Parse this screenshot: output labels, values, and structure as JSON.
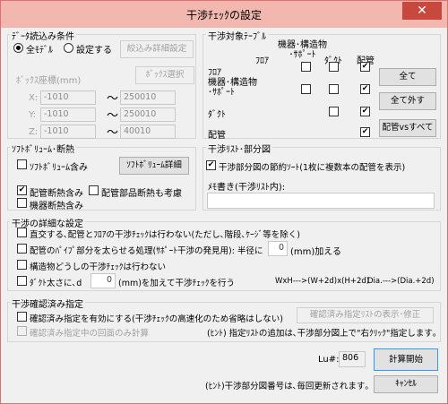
{
  "window": {
    "title": "干渉ﾁｪｯｸの設定",
    "close_glyph": "✕"
  },
  "data_load": {
    "label": "ﾃﾞｰﾀ読込み条件",
    "radio_all": "全ﾓﾃﾞﾙ",
    "radio_set": "設定する",
    "detail_button": "絞込み詳細設定",
    "box_label": "ﾎﾞｯｸｽ座標(mm)",
    "box_button": "ﾎﾞｯｸｽ選択",
    "coords": [
      {
        "axis": "X:",
        "min": "-1010",
        "max": "250010"
      },
      {
        "axis": "Y:",
        "min": "-1010",
        "max": "250010"
      },
      {
        "axis": "Z:",
        "min": "-1010",
        "max": "40010"
      }
    ],
    "tilde": "～"
  },
  "target_table": {
    "label": "干渉対象ﾃｰﾌﾞﾙ",
    "col_headers": [
      "ﾌﾛｱ",
      "機器･構造物\n･ｻﾎﾟｰﾄ",
      "ﾀﾞｸﾄ",
      "配管"
    ],
    "rows": [
      {
        "label": "ﾌﾛｱ",
        "checks": [
          false,
          false,
          true
        ]
      },
      {
        "label": "機器･構造物\n･ｻﾎﾟｰﾄ",
        "checks": [
          false,
          false,
          true
        ]
      },
      {
        "label": "ﾀﾞｸﾄ",
        "checks": [
          false,
          true
        ]
      },
      {
        "label": "配管",
        "checks": [
          true
        ]
      }
    ],
    "btn_all": "全て",
    "btn_none": "全て外す",
    "btn_pipe_all": "配管vsすべて"
  },
  "soft_volume": {
    "label": "ｿﾌﾄﾎﾞﾘｭｰﾑ･断熱",
    "include_soft": "ｿﾌﾄﾎﾞﾘｭｰﾑ含み",
    "soft_detail_button": "ｿﾌﾄﾎﾞﾘｭｰﾑ詳細",
    "pipe_insul": "配管断熱含み",
    "part_insul": "配管部品断熱も考慮",
    "equip_insul": "機器断熱含み"
  },
  "check_list": {
    "label": "干渉ﾘｽﾄ･部分図",
    "save_sort": "干渉部分図の節約ｿｰﾄ(1枚に複数本の配管を表示)",
    "memo_label": "ﾒﾓ書き(干渉ﾘｽﾄ内):",
    "memo_value": ""
  },
  "detail": {
    "label": "干渉の詳細な設定",
    "opt1": "直交する､配管とﾌﾛｱの干渉ﾁｪｯｸは行わない(ただし､階段､ｹｰｼﾞ等を除く)",
    "opt2": "配管のﾊﾟｲﾌﾟ部分を太らせる処理(ｻﾎﾟｰﾄ干渉の発見用): 半径に",
    "opt2_value": "0",
    "opt2_suffix": "(mm)加える",
    "opt3": "構造物どうしの干渉ﾁｪｯｸは行わない",
    "opt4_prefix": "ﾀﾞｸﾄ太さに､d",
    "opt4_value": "0",
    "opt4_suffix": "(mm)を加えて干渉ﾁｪｯｸを行う",
    "opt4_formula1": "WxH--->(W+2d)x(H+2d)",
    "opt4_formula2": "Dia.--->(Dia.+2d)"
  },
  "confirm": {
    "label": "干渉確認済み指定",
    "opt1": "確認済み指定を有効にする(干渉ﾁｪｯｸの高速化のため省略はしない)",
    "list_button": "確認済み指定ﾘｽﾄの表示･修正",
    "opt2": "確認済み指定中の回面のみ計算",
    "hint": "(ﾋﾝﾄ) 指定ﾘｽﾄの追加は､干渉部分図上で\"右ｸﾘｯｸ\"指定します｡"
  },
  "footer": {
    "lu_label": "Lu#:",
    "lu_value": "806",
    "start_button": "計算開始",
    "hint": "(ﾋﾝﾄ)干渉部分図番号は､毎回更新されます｡",
    "cancel_button": "ｷｬﾝｾﾙ"
  }
}
